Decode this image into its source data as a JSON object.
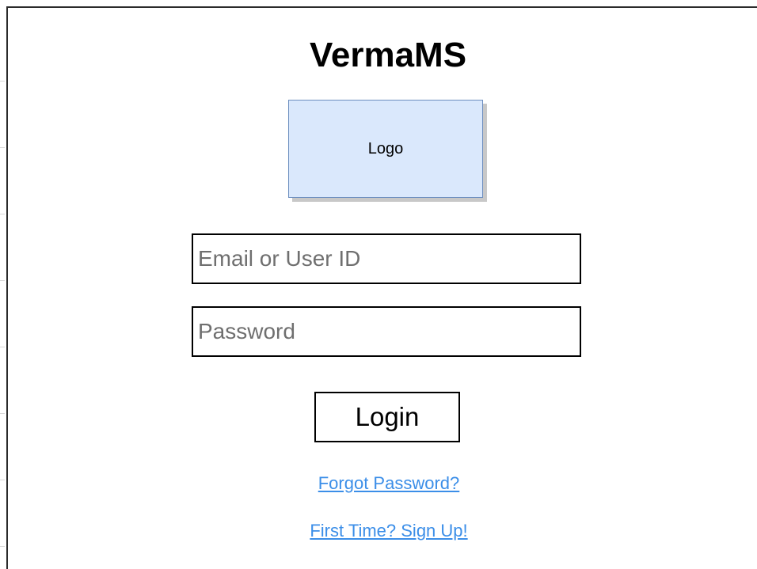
{
  "app": {
    "title": "VermaMS"
  },
  "logo": {
    "label": "Logo"
  },
  "form": {
    "email_placeholder": "Email or User ID",
    "email_value": "",
    "password_placeholder": "Password",
    "password_value": "",
    "login_label": "Login"
  },
  "links": {
    "forgot_password": "Forgot Password?",
    "sign_up": "First Time? Sign Up!"
  },
  "colors": {
    "logo_fill": "#dae8fc",
    "logo_border": "#6c8ebf",
    "link": "#3b8ee8"
  }
}
